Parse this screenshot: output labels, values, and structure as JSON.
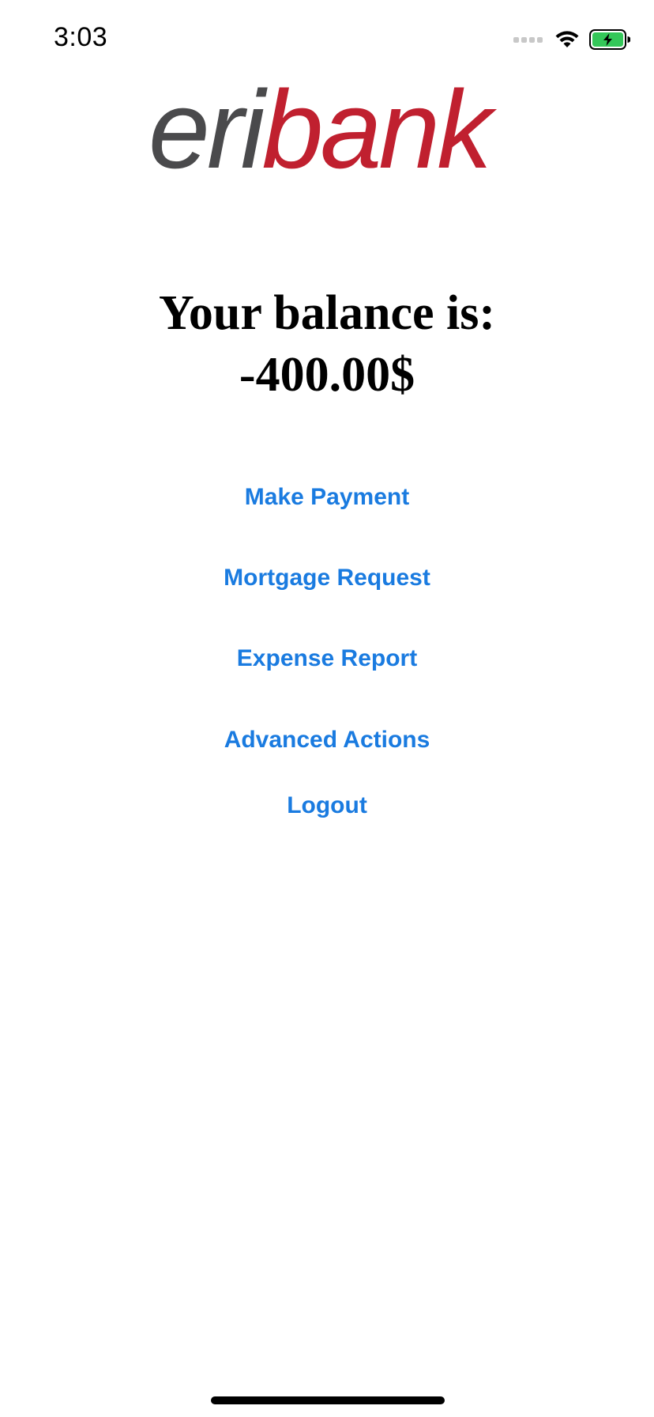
{
  "status_bar": {
    "time": "3:03",
    "signal_icon": "signal-dots-icon",
    "wifi_icon": "wifi-icon",
    "battery_icon": "battery-charging-icon",
    "battery_color": "#34c759"
  },
  "logo": {
    "part1": "eri",
    "part2": "bank",
    "color_part1": "#4a4a4c",
    "color_part2": "#c0202f"
  },
  "balance": {
    "label": "Your balance is:",
    "value": "-400.00$"
  },
  "actions": {
    "make_payment": "Make Payment",
    "mortgage_request": "Mortgage Request",
    "expense_report": "Expense Report",
    "advanced_actions": "Advanced Actions",
    "logout": "Logout",
    "color": "#1a7be0"
  }
}
